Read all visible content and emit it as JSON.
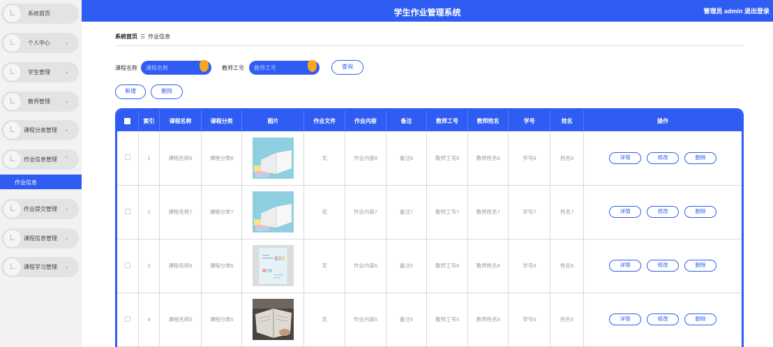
{
  "header": {
    "title": "学生作业管理系统",
    "user": "管理员 admin  退出登录"
  },
  "sidebar": {
    "items": [
      {
        "label": "系统首页",
        "chevron": ""
      },
      {
        "label": "个人中心",
        "chevron": "⌄"
      },
      {
        "label": "学生管理",
        "chevron": "⌄"
      },
      {
        "label": "教师管理",
        "chevron": "⌄"
      },
      {
        "label": "课程分类管理",
        "chevron": "⌄"
      },
      {
        "label": "作业信息管理",
        "chevron": "⌃"
      },
      {
        "label": "作业提交管理",
        "chevron": "⌄"
      },
      {
        "label": "课程信息管理",
        "chevron": "⌄"
      },
      {
        "label": "课程学习管理",
        "chevron": "⌄"
      }
    ],
    "active_sub": "作业信息"
  },
  "breadcrumb": {
    "home": "系统首页",
    "sep": "☰",
    "current": "作业信息"
  },
  "search": {
    "course_label": "课程名称",
    "course_placeholder": "课程名称",
    "teacher_label": "教师工号",
    "teacher_placeholder": "教师工号",
    "query_label": "查询"
  },
  "toolbar": {
    "add_label": "新增",
    "delete_label": "删除"
  },
  "table": {
    "headers": [
      "索引",
      "课程名称",
      "课程分类",
      "图片",
      "作业文件",
      "作业内容",
      "备注",
      "教师工号",
      "教师姓名",
      "学号",
      "姓名",
      "操作"
    ],
    "rows": [
      {
        "index": "1",
        "course": "课程名称8",
        "category": "课程分类8",
        "image": "book-open",
        "file": "无",
        "content": "作业内容8",
        "note": "备注8",
        "teacher_no": "教师工号8",
        "teacher_name": "教师姓名8",
        "student_no": "学号8",
        "name": "姓名8"
      },
      {
        "index": "2",
        "course": "课程名称7",
        "category": "课程分类7",
        "image": "book-open",
        "file": "无",
        "content": "作业内容7",
        "note": "备注7",
        "teacher_no": "教师工号7",
        "teacher_name": "教师姓名7",
        "student_no": "学号7",
        "name": "姓名7"
      },
      {
        "index": "3",
        "course": "课程名称6",
        "category": "课程分类6",
        "image": "booklet",
        "file": "无",
        "content": "作业内容6",
        "note": "备注6",
        "teacher_no": "教师工号6",
        "teacher_name": "教师姓名6",
        "student_no": "学号6",
        "name": "姓名6"
      },
      {
        "index": "4",
        "course": "课程名称5",
        "category": "课程分类5",
        "image": "book-photo",
        "file": "无",
        "content": "作业内容5",
        "note": "备注5",
        "teacher_no": "教师工号5",
        "teacher_name": "教师姓名5",
        "student_no": "学号5",
        "name": "姓名5"
      }
    ],
    "actions": {
      "detail": "详情",
      "edit": "修改",
      "delete": "删除"
    }
  },
  "colors": {
    "accent": "#2f5cf2",
    "knob": "#f5a623"
  }
}
